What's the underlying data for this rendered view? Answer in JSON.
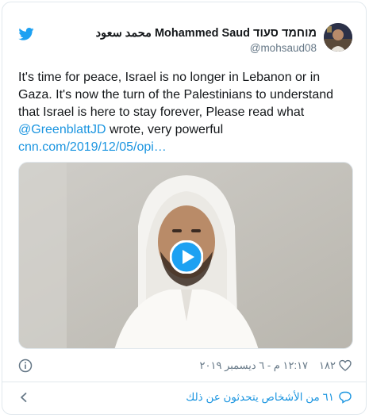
{
  "tweet": {
    "author": {
      "display_name": "محمد سعود Mohammed Saud מוחמד סעוד",
      "handle": "@mohsaud08",
      "avatar_icon": "avatar"
    },
    "text_main": "It's time for peace, Israel is no longer in Lebanon or in Gaza. It's now the turn of the Palestinians to understand that Israel is here to stay forever, Please read what ",
    "mention": "@GreenblattJD",
    "text_after": " wrote, very powerful",
    "link": "cnn.com/2019/12/05/opi…",
    "timestamp": "١٢:١٧ م - ٦ ديسمبر ٢٠١٩",
    "likes": "١٨٢",
    "conversation": "٦١ من الأشخاص يتحدثون عن ذلك"
  },
  "icons": {
    "brand": "twitter-bird-icon",
    "info": "info-icon",
    "like": "heart-icon",
    "reply": "speech-bubble-icon",
    "chevron": "chevron-left-icon",
    "play": "play-icon"
  },
  "colors": {
    "brand": "#1da1f2",
    "link": "#1b95e0",
    "text": "#14171a",
    "muted": "#657786",
    "border": "#e1e8ed"
  }
}
